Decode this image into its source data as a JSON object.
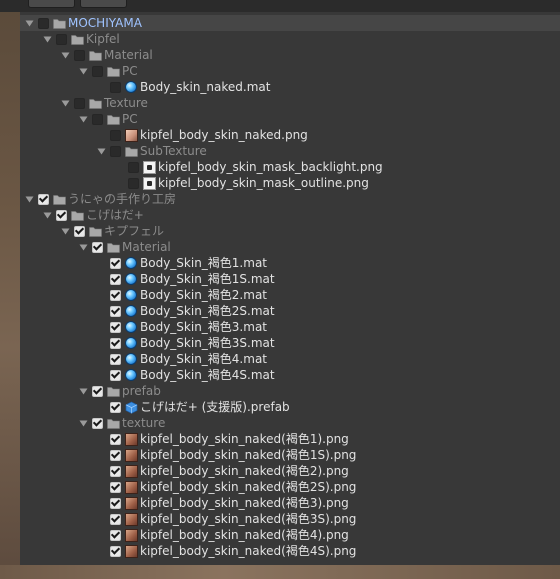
{
  "tree": {
    "rows": [
      {
        "label": "MOCHIYAMA",
        "depth": 0,
        "expanded": true,
        "checked": false,
        "icon": "folder-icon",
        "style": "root"
      },
      {
        "label": "Kipfel",
        "depth": 1,
        "expanded": true,
        "checked": false,
        "icon": "folder-icon",
        "style": "dim"
      },
      {
        "label": "Material",
        "depth": 2,
        "expanded": true,
        "checked": false,
        "icon": "folder-icon",
        "style": "dim"
      },
      {
        "label": "PC",
        "depth": 3,
        "expanded": true,
        "checked": false,
        "icon": "folder-icon",
        "style": "dim"
      },
      {
        "label": "Body_skin_naked.mat",
        "depth": 4,
        "checked": false,
        "icon": "material-icon",
        "style": "bright"
      },
      {
        "label": "Texture",
        "depth": 2,
        "expanded": true,
        "checked": false,
        "icon": "folder-icon",
        "style": "dim"
      },
      {
        "label": "PC",
        "depth": 3,
        "expanded": true,
        "checked": false,
        "icon": "folder-icon",
        "style": "dim"
      },
      {
        "label": "kipfel_body_skin_naked.png",
        "depth": 4,
        "checked": false,
        "icon": "texture-light-icon",
        "style": "bright"
      },
      {
        "label": "SubTexture",
        "depth": 4,
        "expanded": true,
        "checked": false,
        "icon": "folder-icon",
        "style": "dim"
      },
      {
        "label": "kipfel_body_skin_mask_backlight.png",
        "depth": 5,
        "checked": false,
        "icon": "texture-white-icon",
        "style": "bright"
      },
      {
        "label": "kipfel_body_skin_mask_outline.png",
        "depth": 5,
        "checked": false,
        "icon": "texture-white-icon",
        "style": "bright"
      },
      {
        "label": "うにゃの手作り工房",
        "depth": 0,
        "expanded": true,
        "checked": true,
        "icon": "folder-icon",
        "style": "dim"
      },
      {
        "label": "こげはだ+",
        "depth": 1,
        "expanded": true,
        "checked": true,
        "icon": "folder-icon",
        "style": "dim"
      },
      {
        "label": "キプフェル",
        "depth": 2,
        "expanded": true,
        "checked": true,
        "icon": "folder-icon",
        "style": "dim"
      },
      {
        "label": "Material",
        "depth": 3,
        "expanded": true,
        "checked": true,
        "icon": "folder-icon",
        "style": "dim"
      },
      {
        "label": "Body_Skin_褐色1.mat",
        "depth": 4,
        "checked": true,
        "icon": "material-icon",
        "style": "bright"
      },
      {
        "label": "Body_Skin_褐色1S.mat",
        "depth": 4,
        "checked": true,
        "icon": "material-icon",
        "style": "bright"
      },
      {
        "label": "Body_Skin_褐色2.mat",
        "depth": 4,
        "checked": true,
        "icon": "material-icon",
        "style": "bright"
      },
      {
        "label": "Body_Skin_褐色2S.mat",
        "depth": 4,
        "checked": true,
        "icon": "material-icon",
        "style": "bright"
      },
      {
        "label": "Body_Skin_褐色3.mat",
        "depth": 4,
        "checked": true,
        "icon": "material-icon",
        "style": "bright"
      },
      {
        "label": "Body_Skin_褐色3S.mat",
        "depth": 4,
        "checked": true,
        "icon": "material-icon",
        "style": "bright"
      },
      {
        "label": "Body_Skin_褐色4.mat",
        "depth": 4,
        "checked": true,
        "icon": "material-icon",
        "style": "bright"
      },
      {
        "label": "Body_Skin_褐色4S.mat",
        "depth": 4,
        "checked": true,
        "icon": "material-icon",
        "style": "bright"
      },
      {
        "label": "prefab",
        "depth": 3,
        "expanded": true,
        "checked": true,
        "icon": "folder-icon",
        "style": "dim"
      },
      {
        "label": "こげはだ+ (支援版).prefab",
        "depth": 4,
        "checked": true,
        "icon": "prefab-icon",
        "style": "bright"
      },
      {
        "label": "texture",
        "depth": 3,
        "expanded": true,
        "checked": true,
        "icon": "folder-icon",
        "style": "dim"
      },
      {
        "label": "kipfel_body_skin_naked(褐色1).png",
        "depth": 4,
        "checked": true,
        "icon": "texture-dark-icon",
        "style": "bright"
      },
      {
        "label": "kipfel_body_skin_naked(褐色1S).png",
        "depth": 4,
        "checked": true,
        "icon": "texture-dark-icon",
        "style": "bright"
      },
      {
        "label": "kipfel_body_skin_naked(褐色2).png",
        "depth": 4,
        "checked": true,
        "icon": "texture-dark-icon",
        "style": "bright"
      },
      {
        "label": "kipfel_body_skin_naked(褐色2S).png",
        "depth": 4,
        "checked": true,
        "icon": "texture-dark-icon",
        "style": "bright"
      },
      {
        "label": "kipfel_body_skin_naked(褐色3).png",
        "depth": 4,
        "checked": true,
        "icon": "texture-dark-icon",
        "style": "bright"
      },
      {
        "label": "kipfel_body_skin_naked(褐色3S).png",
        "depth": 4,
        "checked": true,
        "icon": "texture-dark-icon",
        "style": "bright"
      },
      {
        "label": "kipfel_body_skin_naked(褐色4).png",
        "depth": 4,
        "checked": true,
        "icon": "texture-dark-icon",
        "style": "bright"
      },
      {
        "label": "kipfel_body_skin_naked(褐色4S).png",
        "depth": 4,
        "checked": true,
        "icon": "texture-dark-icon",
        "style": "bright"
      }
    ]
  },
  "colors": {
    "panel_bg": "#383838",
    "root_label": "#9fc3ff",
    "material_blue": "#2a8fe6"
  }
}
